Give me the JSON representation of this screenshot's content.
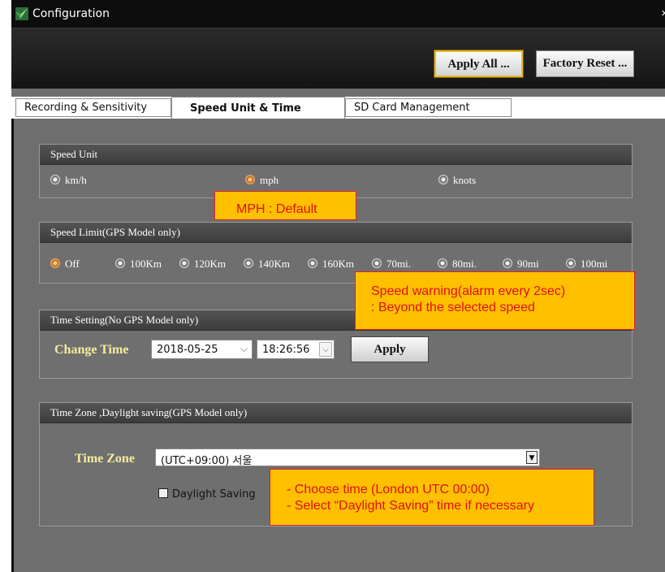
{
  "window": {
    "title": "Configuration",
    "close_glyph": "×"
  },
  "toolbar": {
    "apply_all": "Apply All ...",
    "factory_reset": "Factory Reset ..."
  },
  "tabs": [
    {
      "label": "Recording & Sensitivity",
      "active": false
    },
    {
      "label": "Speed Unit & Time",
      "active": true
    },
    {
      "label": "SD Card Management",
      "active": false
    }
  ],
  "speed_unit": {
    "header": "Speed Unit",
    "options": [
      {
        "label": "km/h",
        "selected": false
      },
      {
        "label": "mph",
        "selected": true
      },
      {
        "label": "knots",
        "selected": false
      }
    ]
  },
  "speed_limit": {
    "header": "Speed Limit(GPS Model only)",
    "options": [
      {
        "label": "Off",
        "selected": true
      },
      {
        "label": "100Km",
        "selected": false
      },
      {
        "label": "120Km",
        "selected": false
      },
      {
        "label": "140Km",
        "selected": false
      },
      {
        "label": "160Km",
        "selected": false
      },
      {
        "label": "70mi.",
        "selected": false
      },
      {
        "label": "80mi.",
        "selected": false
      },
      {
        "label": "90mi",
        "selected": false
      },
      {
        "label": "100mi",
        "selected": false
      }
    ]
  },
  "time_setting": {
    "header": "Time Setting(No GPS Model only)",
    "label": "Change Time",
    "date": "2018-05-25",
    "time": "18:26:56",
    "apply": "Apply"
  },
  "time_zone": {
    "header": "Time Zone ,Daylight saving(GPS Model only)",
    "label": "Time Zone",
    "selected": "(UTC+09:00) 서울",
    "daylight_label": "Daylight Saving",
    "daylight_checked": false
  },
  "annotations": {
    "mph_default": "MPH : Default",
    "speed_warning_1": "Speed warning(alarm every 2sec)",
    "speed_warning_2": ": Beyond the selected speed",
    "timezone_1": "- Choose time (London UTC 00:00)",
    "timezone_2": "- Select “Daylight Saving” time if necessary"
  },
  "colors": {
    "accent_gold": "#ffc000",
    "annotation_red": "#e01010",
    "label_gold": "#f7ec9c"
  },
  "icons": {
    "app": "app-logo-icon",
    "dropdown": "chevron-down-icon"
  }
}
